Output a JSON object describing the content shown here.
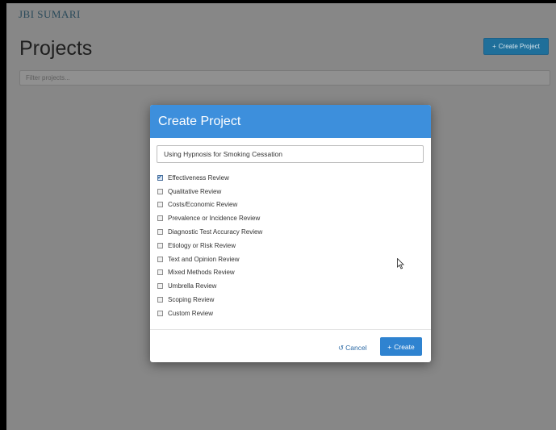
{
  "app": {
    "brand": "JBI SUMARI"
  },
  "header": {
    "title": "Projects",
    "create_button_label": "Create Project",
    "create_icon": "plus-icon"
  },
  "filter": {
    "placeholder": "Filter projects..."
  },
  "modal": {
    "title": "Create Project",
    "project_title_value": "Using Hypnosis for Smoking Cessation",
    "review_types": [
      {
        "label": "Effectiveness Review",
        "checked": true
      },
      {
        "label": "Qualitative Review",
        "checked": false
      },
      {
        "label": "Costs/Economic Review",
        "checked": false
      },
      {
        "label": "Prevalence or Incidence Review",
        "checked": false
      },
      {
        "label": "Diagnostic Test Accuracy Review",
        "checked": false
      },
      {
        "label": "Etiology or Risk Review",
        "checked": false
      },
      {
        "label": "Text and Opinion Review",
        "checked": false
      },
      {
        "label": "Mixed Methods Review",
        "checked": false
      },
      {
        "label": "Umbrella Review",
        "checked": false
      },
      {
        "label": "Scoping Review",
        "checked": false
      },
      {
        "label": "Custom Review",
        "checked": false
      }
    ],
    "cancel_label": "Cancel",
    "cancel_icon": "undo-icon",
    "create_label": "Create",
    "create_icon": "plus-icon"
  },
  "colors": {
    "modal_header": "#3d8fdc",
    "primary_button": "#2f83d0",
    "backdrop": "#878787"
  }
}
